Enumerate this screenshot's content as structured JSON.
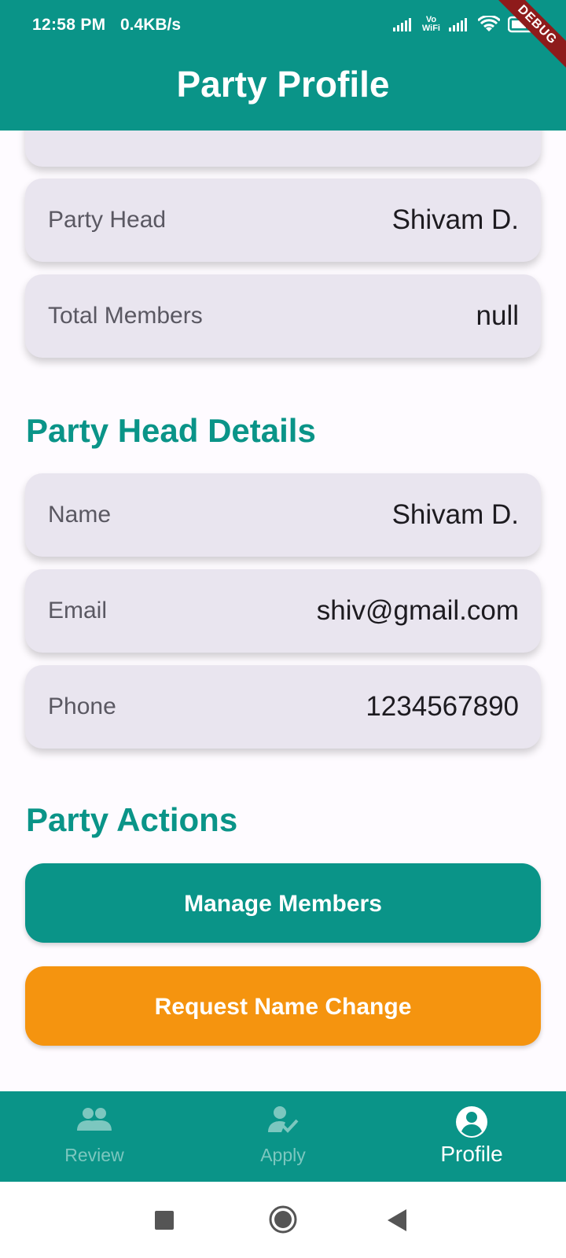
{
  "status_bar": {
    "time": "12:58 PM",
    "speed": "0.4KB/s",
    "volte_label": "Vo\nWiFi",
    "debug_label": "DEBUG"
  },
  "app_bar": {
    "title": "Party Profile"
  },
  "party_info": {
    "rows": [
      {
        "label": "Party Head",
        "value": "Shivam D."
      },
      {
        "label": "Total Members",
        "value": "null"
      }
    ]
  },
  "party_head_details": {
    "title": "Party Head Details",
    "rows": [
      {
        "label": "Name",
        "value": "Shivam D."
      },
      {
        "label": "Email",
        "value": "shiv@gmail.com"
      },
      {
        "label": "Phone",
        "value": "1234567890"
      }
    ]
  },
  "party_actions": {
    "title": "Party Actions",
    "manage_members_label": "Manage Members",
    "request_name_change_label": "Request Name Change"
  },
  "bottom_nav": {
    "items": [
      {
        "label": "Review",
        "icon": "group-icon",
        "active": false
      },
      {
        "label": "Apply",
        "icon": "person-check-icon",
        "active": false
      },
      {
        "label": "Profile",
        "icon": "account-circle-icon",
        "active": true
      }
    ]
  },
  "colors": {
    "primary": "#0a9488",
    "accent_orange": "#f5940f",
    "card_bg": "#e9e5ef",
    "page_bg": "#fefbff"
  }
}
